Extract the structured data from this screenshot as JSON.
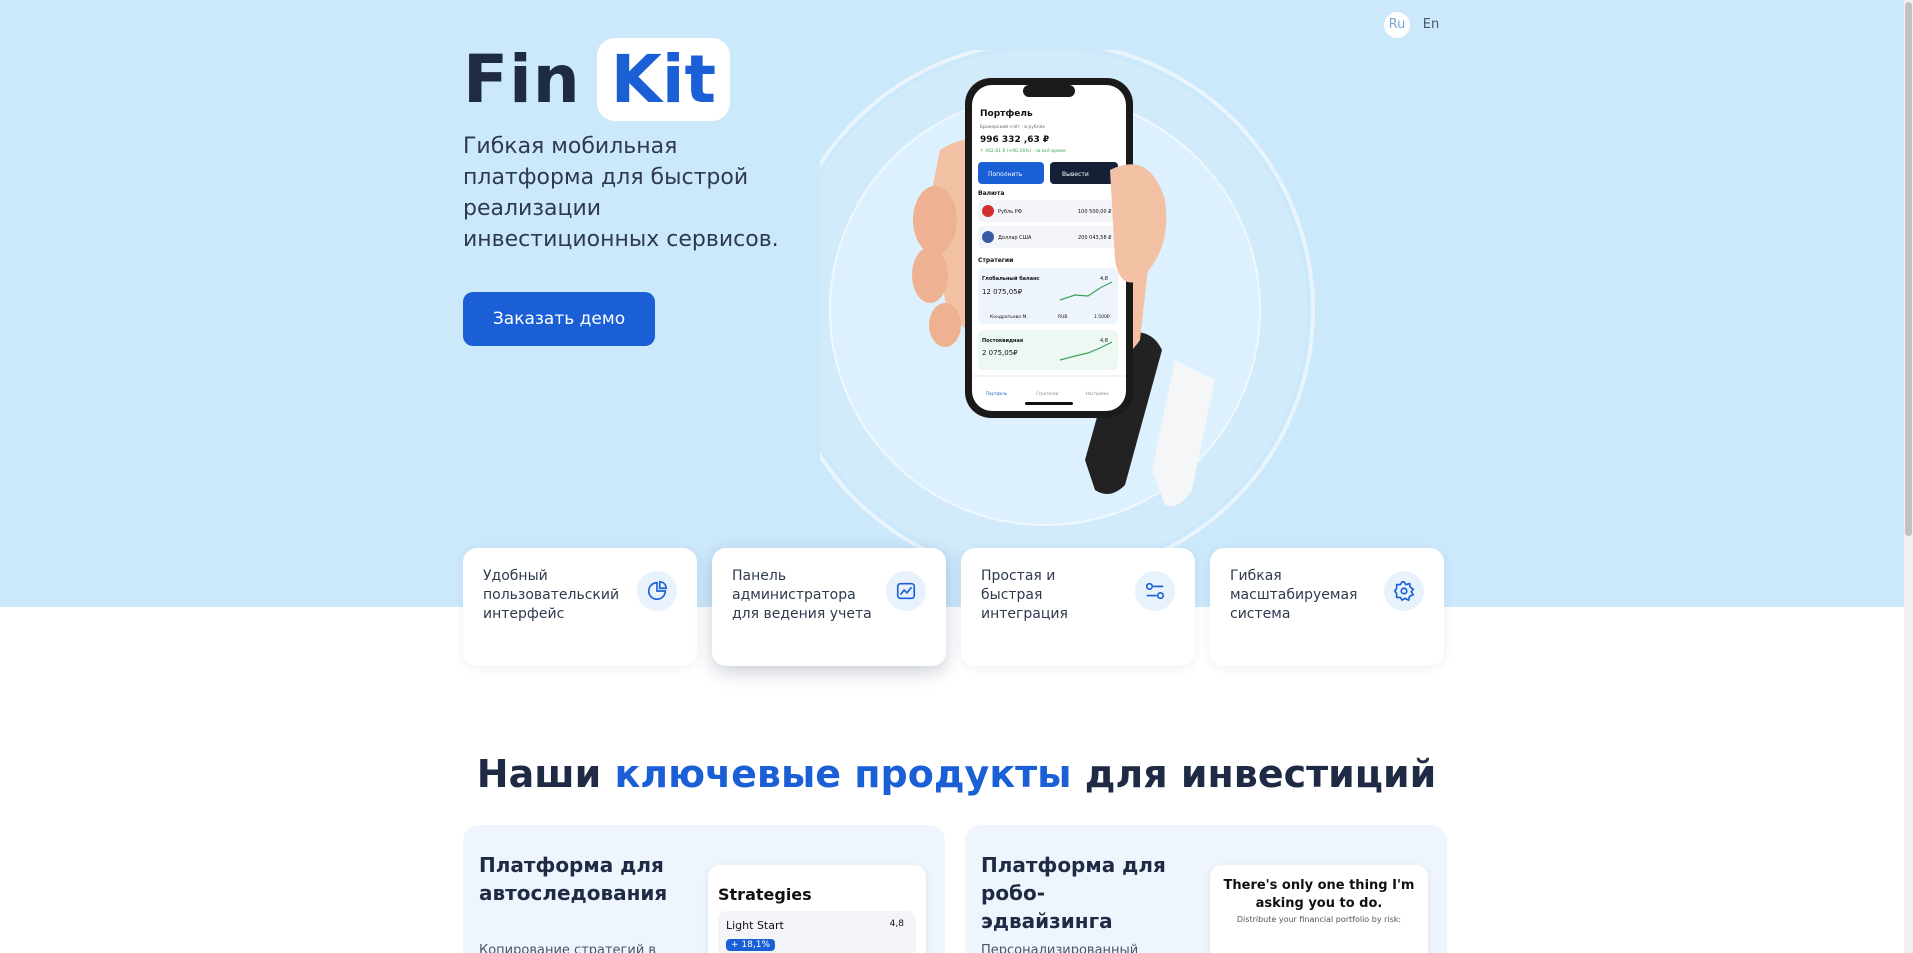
{
  "header": {
    "logo_fin": "Fin",
    "logo_kit": "Kit",
    "languages": [
      {
        "label": "Ru",
        "active": true
      },
      {
        "label": "En",
        "active": false
      }
    ]
  },
  "hero": {
    "tagline": "Гибкая мобильная платформа для быстрой реализации инвестиционных сервисов.",
    "demo_button": "Заказать демо"
  },
  "phone": {
    "title": "Портфель",
    "account_label": "Брокерский счёт · в рублях",
    "balance": "996 332 ,63 ₽",
    "change": "↑ 442,81 ₽ (+60,16%) · за всё время",
    "topup": "Пополнить",
    "withdraw": "Вывести",
    "currency_heading": "Валюта",
    "currencies": [
      {
        "name": "Рубль РФ",
        "value": "100 500,00 ₽"
      },
      {
        "name": "Доллар США",
        "value": "200 043,58 ₽"
      }
    ],
    "strategies_heading": "Стратегии",
    "strategies": [
      {
        "name": "Глобальный баланс",
        "rating": "4,8",
        "value": "12 075,05₽",
        "author": "Кондратьева М.",
        "currency": "RUB",
        "min": "1 500₽"
      },
      {
        "name": "Постоквидная",
        "rating": "4,8",
        "value": "2 075,05₽"
      }
    ],
    "tabs": [
      "Портфель",
      "Стратегии",
      "Настройки"
    ]
  },
  "features": [
    {
      "label": "Удобный пользовательский интерфейс",
      "icon": "pie-chart-icon"
    },
    {
      "label": "Панель администратора для ведения учета",
      "icon": "chart-line-icon"
    },
    {
      "label": "Простая и быстрая интеграция",
      "icon": "sliders-icon"
    },
    {
      "label": "Гибкая масштабируемая система",
      "icon": "gear-icon"
    }
  ],
  "section": {
    "title_before": "Наши ",
    "title_highlight": "ключевые продукты",
    "title_after": " для инвестиций"
  },
  "products": [
    {
      "title": "Платформа для автоследования",
      "desc": "Копирование стратегий в",
      "card_title": "Strategies",
      "card_item": "Light Start",
      "card_rating": "4,8",
      "card_badge": "+ 18,1%"
    },
    {
      "title": "Платформа для робо-эдвайзинга",
      "desc": "Персонализированный",
      "card_title": "There's only one thing I'm asking you to do.",
      "card_sub": "Distribute your financial portfolio by risk:"
    }
  ],
  "colors": {
    "hero_bg": "#cce8fb",
    "accent": "#1a5fd6",
    "text_dark": "#1f2a44"
  }
}
